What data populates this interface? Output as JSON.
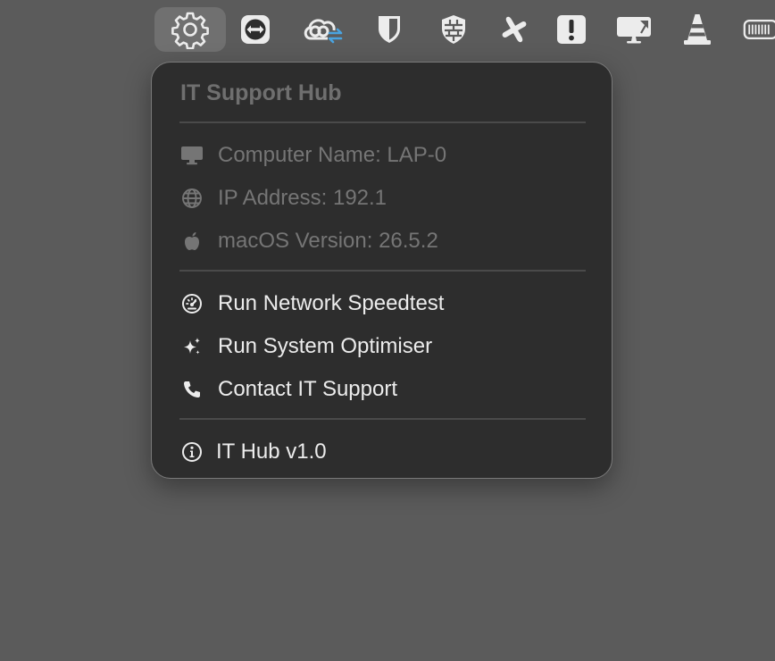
{
  "menubar": {
    "icons": [
      "gear-icon",
      "teamviewer-icon",
      "creative-cloud-sync-icon",
      "bitwarden-shield-icon",
      "firewall-shield-icon",
      "airplane-icon",
      "alert-exclamation-icon",
      "display-cast-icon",
      "traffic-cone-icon",
      "battery-icon"
    ]
  },
  "menu": {
    "title": "IT Support Hub",
    "info": {
      "computer_name": "Computer Name: LAP-0",
      "ip_address": "IP Address: 192.1",
      "macos_version": "macOS Version: 26.5.2"
    },
    "actions": {
      "speedtest": "Run Network Speedtest",
      "optimiser": "Run System Optimiser",
      "contact": "Contact IT Support"
    },
    "version": "IT Hub v1.0"
  },
  "colors": {
    "desktop": "#5b5b5b",
    "menu_bg": "#2d2d2d",
    "menu_border": "#7a7a7a",
    "text_enabled": "#ececec",
    "text_disabled": "#757575"
  }
}
